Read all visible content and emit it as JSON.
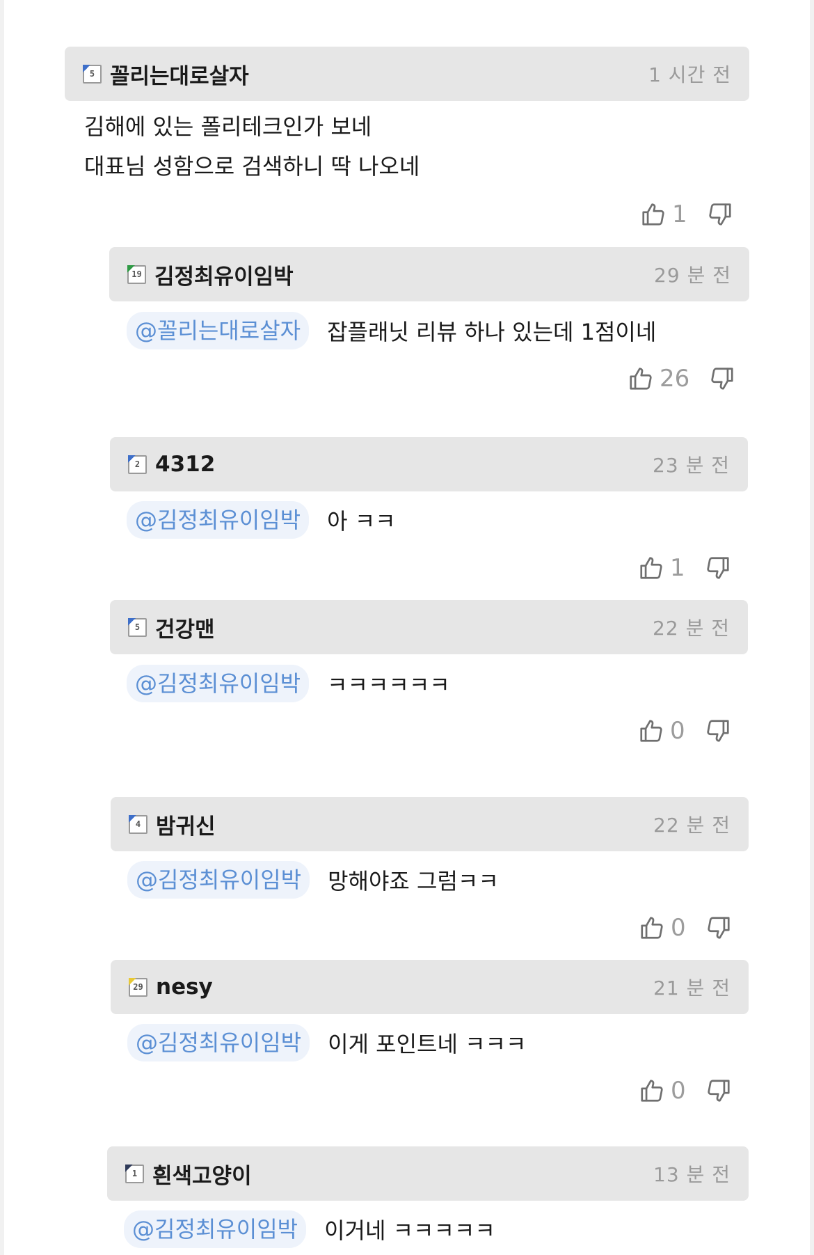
{
  "comments": [
    {
      "nickname": "꼴리는대로살자",
      "level": "5",
      "time": "1 시간 전",
      "lines": [
        "김해에 있는 폴리테크인가 보네",
        "대표님 성함으로 검색하니 딱 나오네"
      ],
      "likes": "1"
    },
    {
      "nickname": "김정최유이임박",
      "level": "19",
      "time": "29 분 전",
      "mention": "@꼴리는대로살자",
      "text": "잡플래닛 리뷰 하나 있는데 1점이네",
      "likes": "26"
    },
    {
      "nickname": "4312",
      "level": "2",
      "time": "23 분 전",
      "mention": "@김정최유이임박",
      "text": "아 ㅋㅋ",
      "likes": "1"
    },
    {
      "nickname": "건강맨",
      "level": "5",
      "time": "22 분 전",
      "mention": "@김정최유이임박",
      "text": "ㅋㅋㅋㅋㅋㅋ",
      "likes": "0"
    },
    {
      "nickname": "밤귀신",
      "level": "4",
      "time": "22 분 전",
      "mention": "@김정최유이임박",
      "text": "망해야죠 그럼ㅋㅋ",
      "likes": "0"
    },
    {
      "nickname": "nesy",
      "level": "29",
      "time": "21 분 전",
      "mention": "@김정최유이임박",
      "text": "이게 포인트네 ㅋㅋㅋ",
      "likes": "0"
    },
    {
      "nickname": "흰색고양이",
      "level": "1",
      "time": "13 분 전",
      "mention": "@김정최유이임박",
      "text": "이거네 ㅋㅋㅋㅋㅋ"
    }
  ],
  "icons": {
    "like": "thumbs-up-icon",
    "dislike": "thumbs-down-icon",
    "level": "level-badge-icon"
  },
  "colors": {
    "header_bg": "#e6e6e6",
    "mention_text": "#5b8fd4",
    "mention_bg": "#eef3fb",
    "time_text": "#9a9a9a",
    "level_blue": "#3e6fc9",
    "level_green": "#2f9a45",
    "level_yellow": "#e8c936"
  }
}
